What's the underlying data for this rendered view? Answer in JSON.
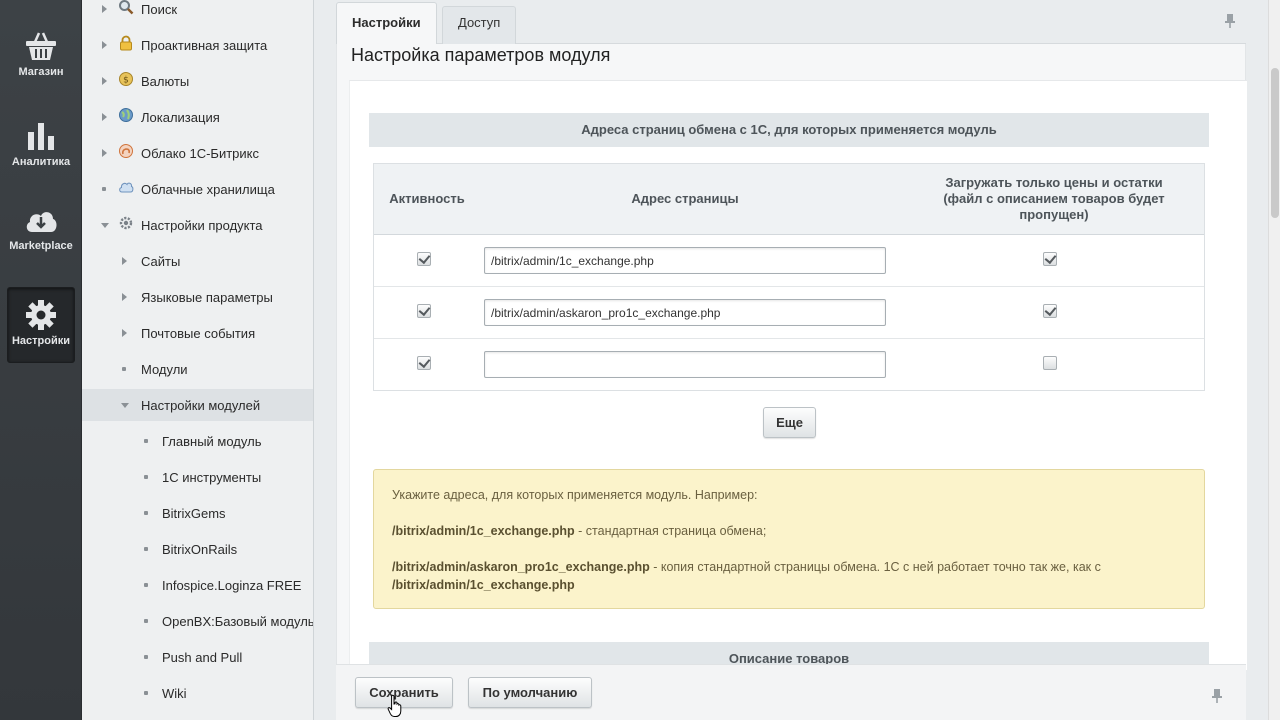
{
  "iconbar": {
    "items": [
      {
        "label": "Магазин",
        "icon": "basket-icon"
      },
      {
        "label": "Аналитика",
        "icon": "bar-chart-icon"
      },
      {
        "label": "Marketplace",
        "icon": "cloud-download-icon"
      },
      {
        "label": "Настройки",
        "icon": "gear-icon",
        "active": true
      }
    ]
  },
  "tree": {
    "items": [
      {
        "label": "Поиск",
        "icon": "magnifier-icon"
      },
      {
        "label": "Проактивная защита",
        "icon": "lock-icon"
      },
      {
        "label": "Валюты",
        "icon": "coins-icon"
      },
      {
        "label": "Локализация",
        "icon": "globe-icon"
      },
      {
        "label": "Облако 1С-Битрикс",
        "icon": "cloud-bitrix-icon"
      },
      {
        "label": "Облачные хранилища",
        "icon": "cloud-storage-icon"
      },
      {
        "label": "Настройки продукта",
        "icon": "settings-icon"
      },
      {
        "label": "Сайты"
      },
      {
        "label": "Языковые параметры"
      },
      {
        "label": "Почтовые события"
      },
      {
        "label": "Модули"
      },
      {
        "label": "Настройки модулей"
      },
      {
        "label": "Главный модуль"
      },
      {
        "label": "1С инструменты"
      },
      {
        "label": "BitrixGems"
      },
      {
        "label": "BitrixOnRails"
      },
      {
        "label": "Infospice.Loginza FREE"
      },
      {
        "label": "OpenBX:Базовый модуль"
      },
      {
        "label": "Push and Pull"
      },
      {
        "label": "Wiki"
      }
    ]
  },
  "tabs": [
    {
      "label": "Настройки"
    },
    {
      "label": "Доступ"
    }
  ],
  "page": {
    "title": "Настройка параметров модуля",
    "section1": "Адреса страниц обмена с 1С, для которых применяется модуль",
    "section2": "Описание товаров"
  },
  "grid": {
    "headers": {
      "activity": "Активность",
      "address": "Адрес страницы",
      "prices_line1": "Загружать только цены и остатки",
      "prices_line2": "(файл с описанием товаров будет",
      "prices_line3": "пропущен)"
    },
    "rows": [
      {
        "active": true,
        "address": "/bitrix/admin/1c_exchange.php",
        "prices_only": true
      },
      {
        "active": true,
        "address": "/bitrix/admin/askaron_pro1c_exchange.php",
        "prices_only": true
      },
      {
        "active": true,
        "address": "",
        "prices_only": false
      }
    ],
    "more_button": "Еще"
  },
  "note": {
    "intro": "Укажите адреса, для которых применяется модуль. Например:",
    "ex1_path": "/bitrix/admin/1c_exchange.php",
    "ex1_text": " - стандартная страница обмена;",
    "ex2_path": "/bitrix/admin/askaron_pro1c_exchange.php",
    "ex2_text": " - копия стандартной страницы обмена. 1С с ней работает точно так же, как с",
    "ex2_tail": "/bitrix/admin/1c_exchange.php"
  },
  "footer": {
    "save": "Сохранить",
    "default": "По умолчанию"
  },
  "colors": {
    "iconbar_bg": "#3a3f43",
    "tree_bg": "#eef0f1",
    "note_bg": "#fbf3cb",
    "section_bg": "#e1e6e9"
  }
}
